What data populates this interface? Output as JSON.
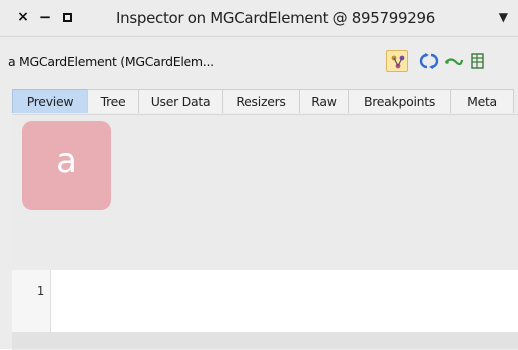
{
  "window": {
    "title": "Inspector on MGCardElement @ 895799296",
    "close_glyph": "×",
    "minimize_glyph": "−",
    "menu_glyph": "▼"
  },
  "toolbar": {
    "object_label": "a MGCardElement (MGCardElem...",
    "icons": [
      "filter-icon",
      "refresh-icon",
      "pointer-icon",
      "grid-icon"
    ],
    "filter_color": "#c98a2b",
    "refresh_color": "#2f6fd1",
    "pointer_color": "#3a9b3a"
  },
  "tabs": [
    {
      "label": "Preview",
      "active": true
    },
    {
      "label": "Tree",
      "active": false
    },
    {
      "label": "User Data",
      "active": false
    },
    {
      "label": "Resizers",
      "active": false
    },
    {
      "label": "Raw",
      "active": false
    },
    {
      "label": "Breakpoints",
      "active": false
    },
    {
      "label": "Meta",
      "active": false
    }
  ],
  "preview": {
    "card_letter": "a",
    "card_color": "#e8aeb4"
  },
  "editor": {
    "line_numbers": [
      "1"
    ]
  }
}
